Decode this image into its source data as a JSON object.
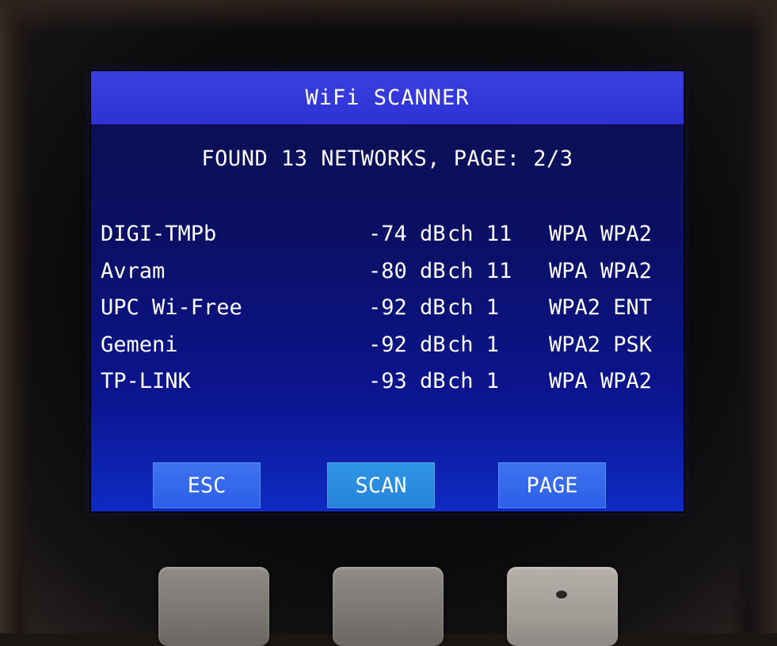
{
  "screen": {
    "title": "WiFi SCANNER",
    "status": "FOUND 13 NETWORKS, PAGE: 2/3",
    "networks": [
      {
        "ssid": "DIGI-TMPb",
        "rssi": "-74 dB",
        "channel": "ch 11",
        "security": "WPA WPA2"
      },
      {
        "ssid": "Avram",
        "rssi": "-80 dB",
        "channel": "ch 11",
        "security": "WPA WPA2"
      },
      {
        "ssid": "UPC Wi-Free",
        "rssi": "-92 dB",
        "channel": "ch 1",
        "security": "WPA2 ENT"
      },
      {
        "ssid": "Gemeni",
        "rssi": "-92 dB",
        "channel": "ch 1",
        "security": "WPA2 PSK"
      },
      {
        "ssid": "TP-LINK",
        "rssi": "-93 dB",
        "channel": "ch 1",
        "security": "WPA WPA2"
      }
    ],
    "buttons": {
      "esc": "ESC",
      "scan": "SCAN",
      "page": "PAGE"
    }
  },
  "colors": {
    "screen_bg": "#0b1066",
    "title_bar": "#2d32d4",
    "button": "#2c5fe6",
    "text": "#ffffff"
  }
}
